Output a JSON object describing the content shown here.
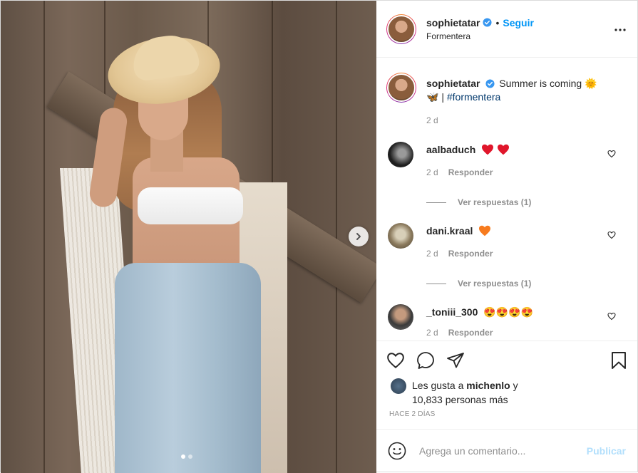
{
  "post": {
    "username": "sophietatar",
    "follow_label": "Seguir",
    "bullet": "•",
    "location": "Formentera"
  },
  "caption": {
    "username": "sophietatar",
    "text": "Summer is coming 🌞",
    "emoji_butterfly": "🦋",
    "separator": "|",
    "hashtag": "#formentera",
    "time": "2 d"
  },
  "comments": [
    {
      "username": "aalbaduch",
      "text": "",
      "time": "2 d",
      "reply_label": "Responder",
      "view_replies": "Ver respuestas (1)",
      "avatar_color": "#2b2b2b",
      "hearts": "red-red"
    },
    {
      "username": "dani.kraal",
      "text": "",
      "time": "2 d",
      "reply_label": "Responder",
      "view_replies": "Ver respuestas (1)",
      "avatar_color": "#7a6a52",
      "hearts": "orange"
    },
    {
      "username": "_toniii_300",
      "text": "😍😍😍😍",
      "time": "2 d",
      "reply_label": "Responder",
      "avatar_color": "#4a4a4a"
    }
  ],
  "likes": {
    "prefix": "Les gusta a",
    "user": "michenlo",
    "conj": "y",
    "count_text": "10,833 personas más"
  },
  "time_ago": "HACE 2 DÍAS",
  "add_comment": {
    "placeholder": "Agrega un comentario...",
    "publish_label": "Publicar"
  },
  "carousel": {
    "total": 2,
    "current": 1
  },
  "colors": {
    "accent": "#0095f6",
    "text": "#262626",
    "muted": "#8e8e8e",
    "hashtag": "#00376b",
    "heart_red": "#ed4956",
    "heart_orange": "#f77b1e"
  }
}
